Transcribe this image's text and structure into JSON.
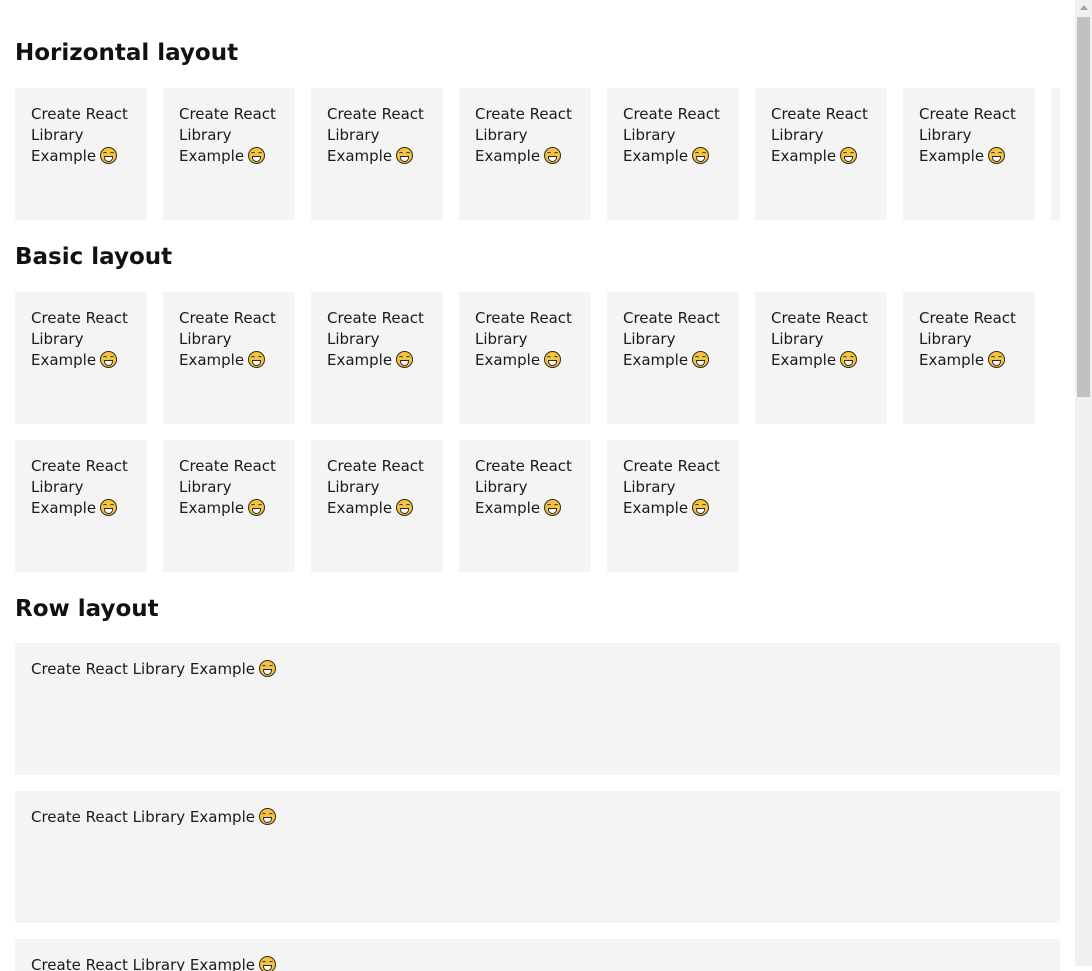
{
  "sections": {
    "horizontal": {
      "title": "Horizontal layout"
    },
    "basic": {
      "title": "Basic layout"
    },
    "row": {
      "title": "Row layout"
    }
  },
  "card": {
    "line1": "Create React",
    "line2": "Library",
    "line3": "Example",
    "full_text": "Create React Library Example",
    "emoji_name": "grinning-face-icon"
  }
}
